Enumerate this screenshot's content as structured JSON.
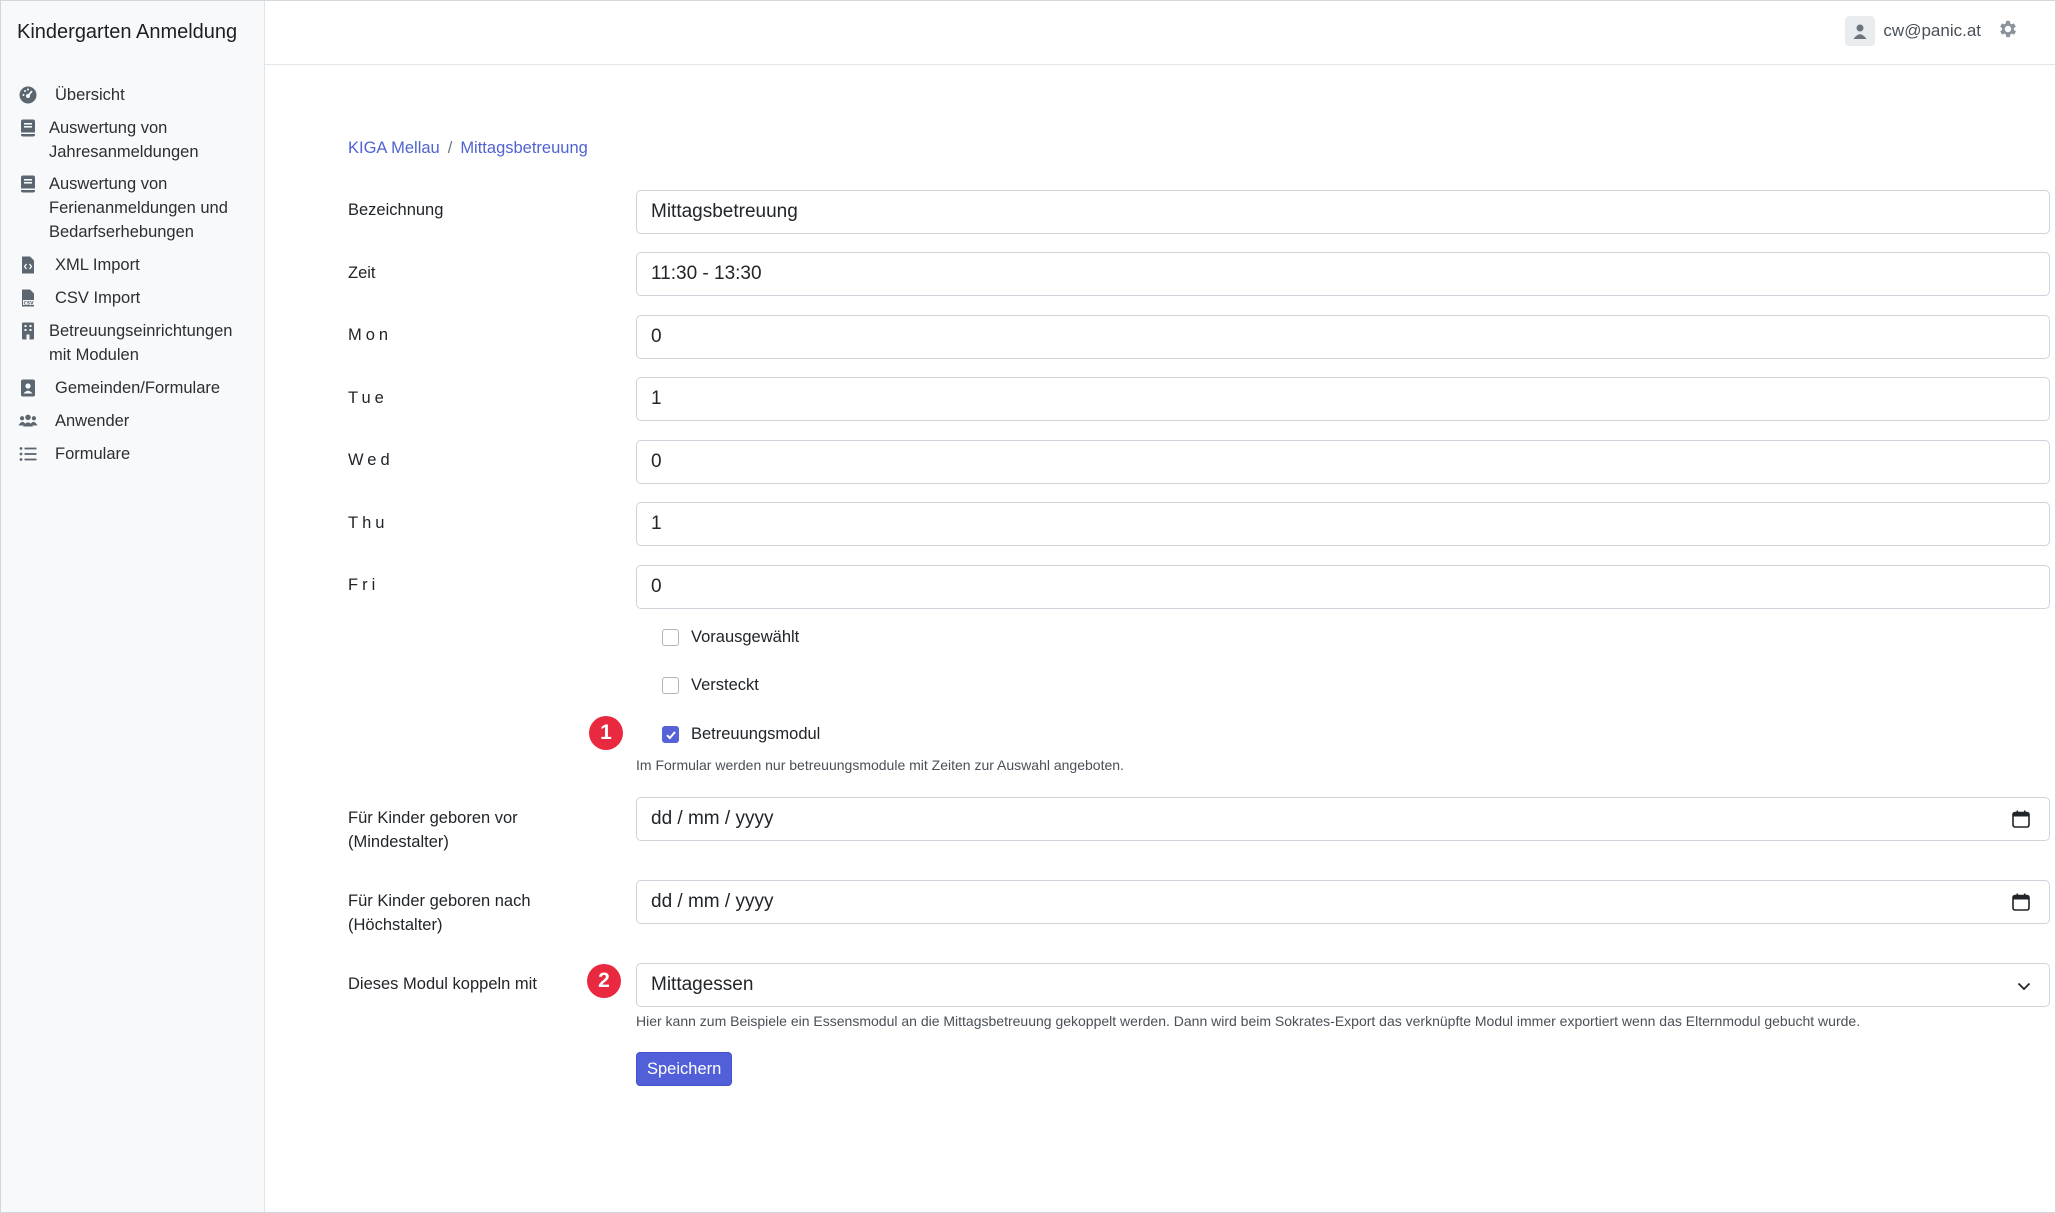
{
  "app": {
    "brand": "Kindergarten Anmeldung"
  },
  "sidebar": {
    "items": [
      {
        "label": "Übersicht",
        "icon": "dashboard-icon"
      },
      {
        "label": "Auswertung von Jahresanmeldungen",
        "icon": "book-icon"
      },
      {
        "label": "Auswertung von Ferienanmeldungen und Bedarfserhebungen",
        "icon": "book-icon"
      },
      {
        "label": "XML Import",
        "icon": "file-code-icon"
      },
      {
        "label": "CSV Import",
        "icon": "file-csv-icon"
      },
      {
        "label": "Betreuungseinrichtungen mit Modulen",
        "icon": "building-icon"
      },
      {
        "label": "Gemeinden/Formulare",
        "icon": "address-book-icon"
      },
      {
        "label": "Anwender",
        "icon": "users-icon"
      },
      {
        "label": "Formulare",
        "icon": "list-icon"
      }
    ]
  },
  "header": {
    "user_email": "cw@panic.at"
  },
  "breadcrumb": {
    "parent": "KIGA Mellau",
    "separator": "/",
    "current": "Mittagsbetreuung"
  },
  "form": {
    "bezeichnung": {
      "label": "Bezeichnung",
      "value": "Mittagsbetreuung"
    },
    "zeit": {
      "label": "Zeit",
      "value": "11:30 - 13:30"
    },
    "mon": {
      "label": "Mon",
      "value": "0"
    },
    "tue": {
      "label": "Tue",
      "value": "1"
    },
    "wed": {
      "label": "Wed",
      "value": "0"
    },
    "thu": {
      "label": "Thu",
      "value": "1"
    },
    "fri": {
      "label": "Fri",
      "value": "0"
    },
    "vorausgewaehlt": {
      "label": "Vorausgewählt",
      "checked": false
    },
    "versteckt": {
      "label": "Versteckt",
      "checked": false
    },
    "betreuungsmodul": {
      "label": "Betreuungsmodul",
      "checked": true
    },
    "betreuungsmodul_help": "Im Formular werden nur betreuungsmodule mit Zeiten zur Auswahl angeboten.",
    "min_age": {
      "label_line1": "Für Kinder geboren vor",
      "label_line2": "(Mindestalter)",
      "value": "dd / mm / yyyy"
    },
    "max_age": {
      "label_line1": "Für Kinder geboren nach",
      "label_line2": "(Höchstalter)",
      "value": "dd / mm / yyyy"
    },
    "koppeln": {
      "label": "Dieses Modul koppeln mit",
      "value": "Mittagessen"
    },
    "koppeln_help": "Hier kann zum Beispiele ein Essensmodul an die Mittagsbetreuung gekoppelt werden. Dann wird beim Sokrates-Export das verknüpfte Modul immer exportiert wenn das Elternmodul gebucht wurde.",
    "save_label": "Speichern"
  },
  "annotations": {
    "marker1": "1",
    "marker2": "2"
  },
  "colors": {
    "accent": "#5160d9",
    "link": "#4f63d2",
    "marker": "#e8293f",
    "sidebar_bg": "#f8f9fa"
  }
}
